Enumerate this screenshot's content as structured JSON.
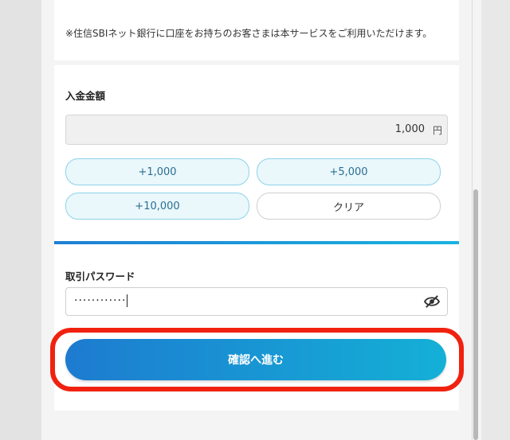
{
  "notice": "※住信SBIネット銀行に口座をお持ちのお客さまは本サービスをご利用いただけます。",
  "deposit": {
    "label": "入金金額",
    "value": "1,000",
    "unit": "円",
    "quick_buttons": [
      "+1,000",
      "+5,000",
      "+10,000"
    ],
    "clear_label": "クリア"
  },
  "password": {
    "label": "取引パスワード",
    "masked_value": "············",
    "toggle_icon": "eye-slash-icon"
  },
  "confirm_label": "確認へ進む",
  "colors": {
    "accent_start": "#1d7bd0",
    "accent_end": "#14b0d6",
    "highlight": "#f0220f",
    "chip_fill": "#eaf7fb",
    "chip_border": "#8ed3e8"
  }
}
